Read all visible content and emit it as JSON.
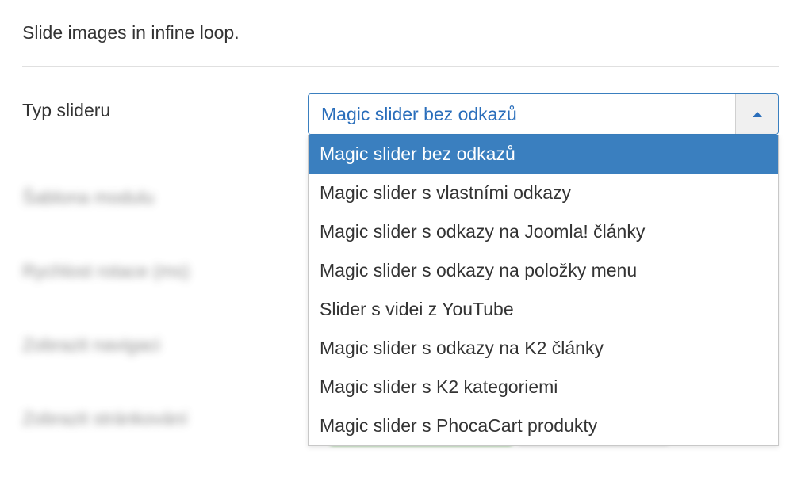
{
  "intro": "Slide images in infine loop.",
  "fields": {
    "slider_type": {
      "label": "Typ slideru",
      "value": "Magic slider bez odkazů",
      "options": [
        "Magic slider bez odkazů",
        "Magic slider s vlastními odkazy",
        "Magic slider s odkazy na Joomla! články",
        "Magic slider s odkazy na položky menu",
        "Slider s videi z YouTube",
        "Magic slider s odkazy na K2 články",
        "Magic slider s K2 kategoriemi",
        "Magic slider s PhocaCart produkty"
      ]
    },
    "template": {
      "label": "Šablona modulu"
    },
    "speed": {
      "label": "Rychlost rotace (ms)"
    },
    "nav": {
      "label": "Zobrazit navigaci"
    },
    "pagination": {
      "label": "Zobrazit stránkování"
    }
  }
}
